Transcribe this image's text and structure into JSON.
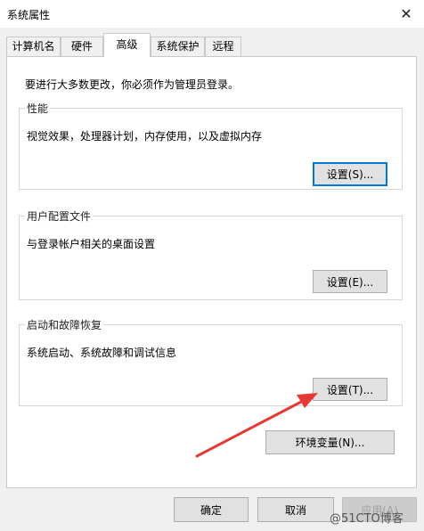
{
  "window": {
    "title": "系统属性"
  },
  "tabs": [
    {
      "label": "计算机名"
    },
    {
      "label": "硬件"
    },
    {
      "label": "高级"
    },
    {
      "label": "系统保护"
    },
    {
      "label": "远程"
    }
  ],
  "panel": {
    "intro": "要进行大多数更改，你必须作为管理员登录。",
    "groups": [
      {
        "legend": "性能",
        "desc": "视觉效果，处理器计划，内存使用，以及虚拟内存",
        "button": "设置(S)..."
      },
      {
        "legend": "用户配置文件",
        "desc": "与登录帐户相关的桌面设置",
        "button": "设置(E)..."
      },
      {
        "legend": "启动和故障恢复",
        "desc": "系统启动、系统故障和调试信息",
        "button": "设置(T)..."
      }
    ],
    "env_button": "环境变量(N)..."
  },
  "footer": {
    "ok": "确定",
    "cancel": "取消",
    "apply": "应用(A)"
  },
  "overlay": {
    "watermark": "@51CTO博客",
    "arrow_color": "#e53935",
    "focus_color": "#0078d7"
  }
}
